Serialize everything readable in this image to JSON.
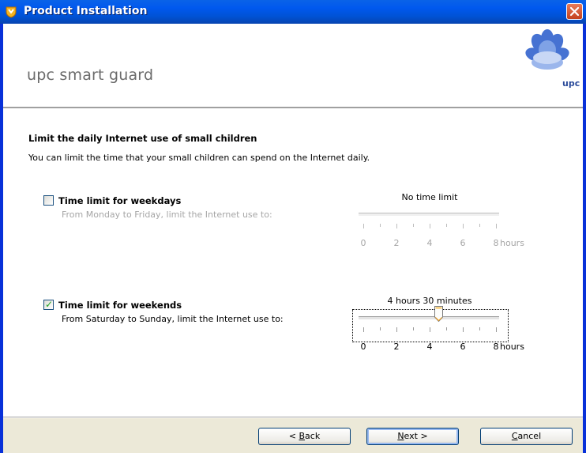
{
  "window": {
    "title": "Product Installation"
  },
  "header": {
    "product_name": "upc smart guard",
    "logo_text": "upc"
  },
  "page": {
    "heading": "Limit the daily Internet use of small children",
    "description": "You can limit the time that your small children can spend on the Internet daily."
  },
  "weekdays": {
    "label": "Time limit for weekdays",
    "checked": false,
    "sublabel": "From Monday to Friday, limit the Internet use to:",
    "value_text": "No time limit",
    "enabled": false
  },
  "weekends": {
    "label": "Time limit for weekends",
    "checked": true,
    "sublabel": "From Saturday to Sunday, limit the Internet use to:",
    "value_text": "4 hours 30 minutes",
    "value_hours": 4.5,
    "enabled": true
  },
  "scale": {
    "labels": [
      "0",
      "2",
      "4",
      "6",
      "8"
    ],
    "unit": "hours",
    "min": 0,
    "max": 8,
    "tick_count": 9
  },
  "buttons": {
    "back_prefix": "< ",
    "back_key": "B",
    "back_rest": "ack",
    "next_key": "N",
    "next_rest": "ext >",
    "cancel_key": "C",
    "cancel_rest": "ancel"
  },
  "colors": {
    "titlebar": "#0058ee",
    "frame": "#0831d9",
    "footer": "#ece9d8",
    "check": "#21a121",
    "disabled_text": "#a6a6a6"
  },
  "icons": {
    "title_icon": "shield-icon",
    "close": "close-icon",
    "logo": "upc-logo-icon",
    "check": "checkmark-icon",
    "slider_thumb": "slider-thumb-icon"
  }
}
